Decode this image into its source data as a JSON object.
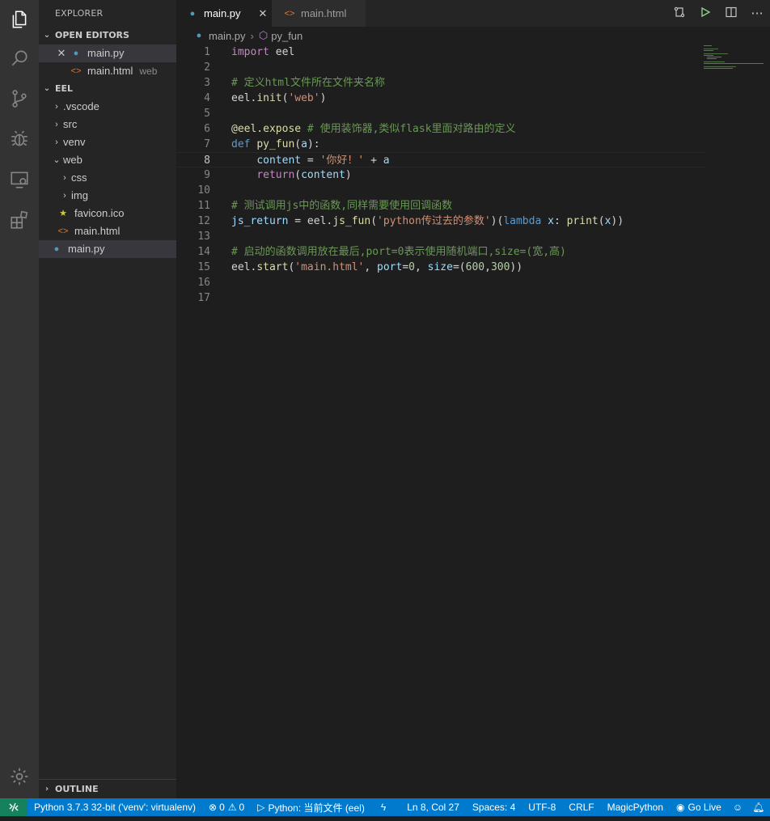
{
  "explorer": {
    "title": "EXPLORER",
    "open_editors_label": "OPEN EDITORS",
    "open_editors": [
      {
        "name": "main.py",
        "desc": "",
        "icon": "python-file-icon"
      },
      {
        "name": "main.html",
        "desc": "web",
        "icon": "html-file-icon"
      }
    ],
    "folder_label": "EEL",
    "tree": [
      {
        "name": ".vscode",
        "type": "folder",
        "expanded": false
      },
      {
        "name": "src",
        "type": "folder",
        "expanded": false
      },
      {
        "name": "venv",
        "type": "folder",
        "expanded": false
      },
      {
        "name": "web",
        "type": "folder",
        "expanded": true
      },
      {
        "name": "css",
        "type": "folder",
        "expanded": false
      },
      {
        "name": "img",
        "type": "folder",
        "expanded": false
      },
      {
        "name": "favicon.ico",
        "type": "file"
      },
      {
        "name": "main.html",
        "type": "file"
      },
      {
        "name": "main.py",
        "type": "file"
      }
    ],
    "outline_label": "OUTLINE"
  },
  "tabs": [
    {
      "label": "main.py",
      "active": true
    },
    {
      "label": "main.html",
      "active": false
    }
  ],
  "breadcrumb": {
    "file": "main.py",
    "symbol": "py_fun"
  },
  "editor": {
    "current_line": 8,
    "line_numbers": [
      "1",
      "2",
      "3",
      "4",
      "5",
      "6",
      "7",
      "8",
      "9",
      "10",
      "11",
      "12",
      "13",
      "14",
      "15",
      "16",
      "17"
    ],
    "code_lines": [
      "import eel",
      "",
      "# 定义html文件所在文件夹名称",
      "eel.init('web')",
      "",
      "@eel.expose # 使用装饰器,类似flask里面对路由的定义",
      "def py_fun(a):",
      "    content = '你好！' + a",
      "    return(content)",
      "",
      "# 测试调用js中的函数,同样需要使用回调函数",
      "js_return = eel.js_fun('python传过去的参数')(lambda x: print(x))",
      "",
      "# 启动的函数调用放在最后,port=0表示使用随机端口,size=(宽,高)",
      "eel.start('main.html', port=0, size=(600,300))",
      "",
      ""
    ]
  },
  "statusbar": {
    "interpreter": "Python 3.7.3 32-bit ('venv': virtualenv)",
    "errors": "0",
    "warnings": "0",
    "run_config": "Python: 当前文件 (eel)",
    "cursor": "Ln 8, Col 27",
    "spaces": "Spaces: 4",
    "encoding": "UTF-8",
    "eol": "CRLF",
    "language": "MagicPython",
    "golive": "Go Live"
  },
  "colors": {
    "statusbar": "#007acc",
    "remote": "#16825d",
    "sidebar": "#252526",
    "activitybar": "#333333",
    "editor": "#1e1e1e"
  }
}
